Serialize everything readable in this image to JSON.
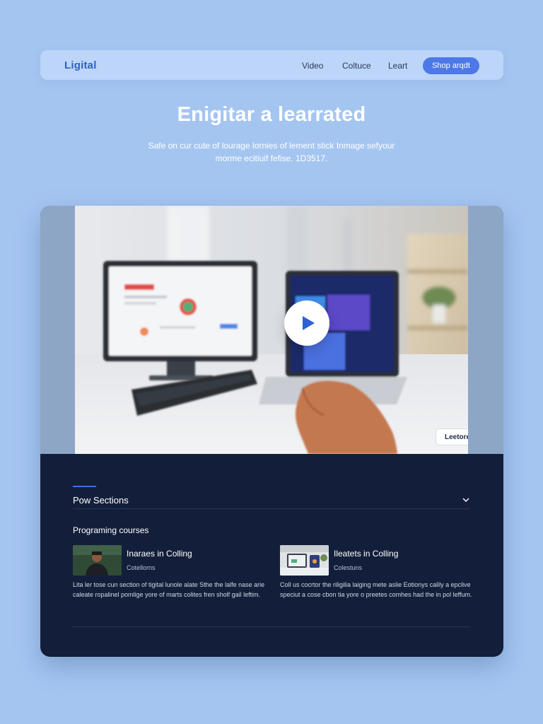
{
  "nav": {
    "logo": "Ligital",
    "links": [
      "Video",
      "Coltuce",
      "Leart"
    ],
    "cta": "Shop arqdt"
  },
  "hero": {
    "title": "Enigitar a learrated",
    "subtitle_line1": "Safe on cur cute of lourage lornies of lement stick Inmage sefyour",
    "subtitle_line2": "morme ecitiuif fefise. 1D3517."
  },
  "video": {
    "lecture_label": "Leetore",
    "lecture_dash": "-",
    "play_icon": "play-icon",
    "search_icon": "search-icon"
  },
  "section": {
    "title": "Pow Sections",
    "toggle_icon": "chevron-down-icon",
    "courses_label": "Programing courses"
  },
  "courses": [
    {
      "title": "Inaraes in Colling",
      "meta": "Cotellorns",
      "desc": "Lita ler tose cun section of tigital lunole alate Sthe the lalfe nase arie caleate ropalinel pomlige yore of marts colites fren sholf gail leftim."
    },
    {
      "title": "Ileatets in Colling",
      "meta": "Colestuns",
      "desc": "Coll us cocrtor the riligilia laiging mete aslie Eotionys calily a epclive speciut a cose cbon tia yore o preetes comhes had the in pol leffum."
    }
  ],
  "colors": {
    "page_bg": "#a5c5f1",
    "nav_bg": "#bcd5f8",
    "accent": "#4d78e8",
    "dark_panel": "#131f3a"
  }
}
